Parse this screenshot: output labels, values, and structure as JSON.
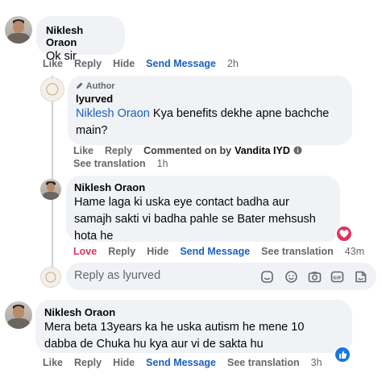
{
  "comment1": {
    "name": "Niklesh Oraon",
    "text": "Ok sir",
    "actions": [
      "Like",
      "Reply",
      "Hide",
      "Send Message"
    ],
    "time": "2h"
  },
  "comment2": {
    "badge": "Author",
    "name": "lyurved",
    "mention": "Niklesh Oraon",
    "text_line1": " Kya benefits dekhe apne bachche",
    "text_line2": "main?",
    "like": "Like",
    "reply": "Reply",
    "commented_on": "Commented on by",
    "commented_by": "Vandita IYD",
    "see_translation": "See translation",
    "time": "1h"
  },
  "comment3": {
    "name": "Niklesh Oraon",
    "text_line1": "Hame laga ki uska eye contact badha aur",
    "text_line2": "samajh sakti vi badha pahle se Bater mehsush",
    "text_line3": "hota he",
    "love": "Love",
    "reply": "Reply",
    "hide": "Hide",
    "send_message": "Send Message",
    "see_translation": "See translation",
    "time": "43m"
  },
  "reply_box": {
    "placeholder": "Reply as lyurved"
  },
  "comment4": {
    "name": "Niklesh Oraon",
    "text_line1": "Mera beta 13years ka he uska autism he mene 10",
    "text_line2": "dabba de Chuka hu kya aur vi de sakta hu",
    "like": "Like",
    "reply": "Reply",
    "hide": "Hide",
    "send_message": "Send Message",
    "see_translation": "See translation",
    "time": "3h"
  },
  "colors": {
    "link_blue": "#1b5fc1",
    "love_red": "#e0335a",
    "bubble_gray": "#f0f2f5",
    "meta_gray": "#65676b"
  }
}
